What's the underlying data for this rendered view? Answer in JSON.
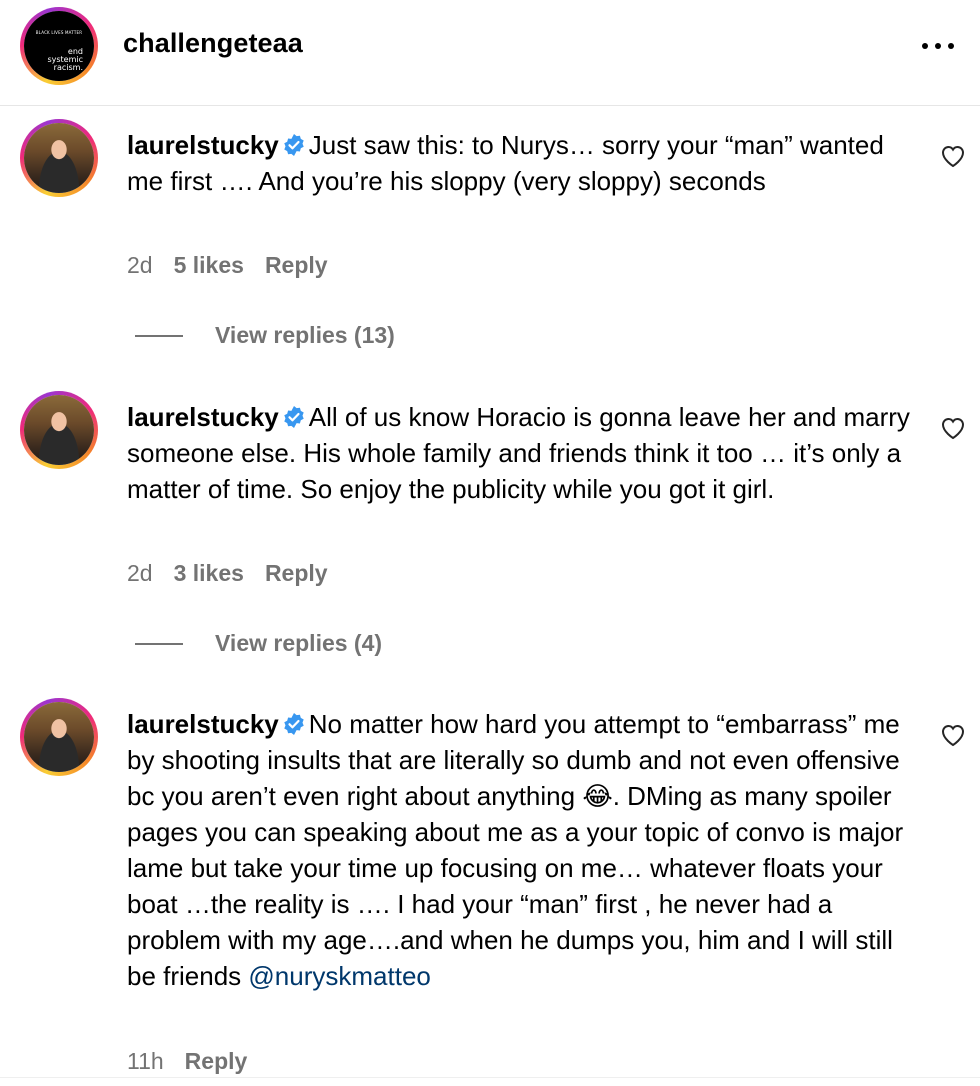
{
  "post": {
    "username": "challengeteaa",
    "avatar_text_top": "BLACK LIVES MATTER",
    "avatar_text_lines": [
      "end",
      "systemic",
      "racism."
    ]
  },
  "comments": [
    {
      "username": "laurelstucky",
      "verified": true,
      "text": "Just saw this: to Nurys… sorry your “man” wanted me first …. And you’re his sloppy (very sloppy) seconds",
      "time": "2d",
      "likes": "5 likes",
      "reply_label": "Reply",
      "view_replies": "View replies (13)"
    },
    {
      "username": "laurelstucky",
      "verified": true,
      "text": "All of us know Horacio is gonna leave her and marry someone else. His whole family and friends think it too … it’s only a matter of time. So enjoy the publicity while you got it girl.",
      "time": "2d",
      "likes": "3 likes",
      "reply_label": "Reply",
      "view_replies": "View replies (4)"
    },
    {
      "username": "laurelstucky",
      "verified": true,
      "text_before_emoji": "No matter how hard you attempt to “embarrass” me by shooting insults that are literally so dumb and not even offensive bc you aren’t even right about anything ",
      "emoji": "😂",
      "text_after_emoji": ". DMing as many spoiler pages you can speaking about me as a your topic of convo is major lame but take your time up focusing on me… whatever floats your boat …the reality is …. I had your “man” first , he never had a problem with my age….and when he dumps you, him and I will still be friends ",
      "mention": "@nuryskmatteo",
      "time": "11h",
      "reply_label": "Reply"
    }
  ],
  "colors": {
    "accent_verified": "#3897f0",
    "meta_gray": "#737373",
    "mention_blue": "#00376b"
  },
  "icons": {
    "more": "more-horizontal-icon",
    "like": "heart-outline-icon",
    "verified": "verified-badge-icon"
  }
}
